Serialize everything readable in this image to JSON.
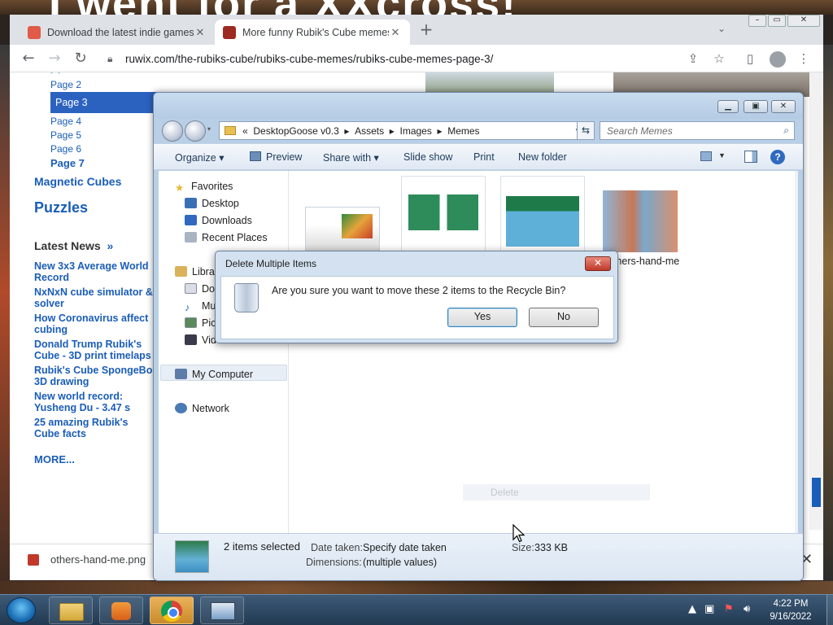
{
  "wallpaper_text": "I went for a XXcross!",
  "chrome": {
    "tabs": [
      {
        "title": "Download the latest indie games",
        "fav_color": "#e05a47"
      },
      {
        "title": "More funny Rubik's Cube memes",
        "fav_color": "#9c2a20"
      }
    ],
    "new_tab": "+",
    "tab_close": "✕",
    "url": "ruwix.com/the-rubiks-cube/rubiks-cube-memes/rubiks-cube-memes-page-3/",
    "download": {
      "filename": "others-hand-me.png"
    }
  },
  "webpage": {
    "subpages": [
      "Page 2",
      "Page 3",
      "Page 4",
      "Page 5",
      "Page 6",
      "Page 7"
    ],
    "magnetic": "Magnetic Cubes",
    "puzzles": "Puzzles",
    "latest_news": "Latest News",
    "latest_arrow": "»",
    "news": [
      [
        "New 3x3 Average World",
        "Record"
      ],
      [
        "NxNxN cube simulator &",
        "solver"
      ],
      [
        "How Coronavirus affect",
        "cubing"
      ],
      [
        "Donald Trump Rubik's",
        "Cube - 3D print timelaps"
      ],
      [
        "Rubik's Cube SpongeBo",
        "3D drawing"
      ],
      [
        "New world record:",
        "Yusheng Du - 3.47 s"
      ],
      [
        "25 amazing Rubik's",
        "Cube facts"
      ]
    ],
    "more": "MORE..."
  },
  "explorer": {
    "breadcrumb": [
      "«",
      "DesktopGoose v0.3",
      "Assets",
      "Images",
      "Memes"
    ],
    "search_placeholder": "Search Memes",
    "commands": {
      "organize": "Organize ▾",
      "preview": "Preview",
      "share": "Share with ▾",
      "slideshow": "Slide show",
      "print": "Print",
      "new_folder": "New folder"
    },
    "nav": {
      "favorites": "Favorites",
      "desktop": "Desktop",
      "downloads": "Downloads",
      "recent": "Recent Places",
      "libraries": "Libra",
      "documents": "Doc",
      "music": "Mu",
      "pictures": "Pic",
      "videos": "Vid",
      "computer": "My Computer",
      "network": "Network"
    },
    "file_label": "others-hand-me",
    "ghost_label": "Delete",
    "details": {
      "selected": "2 items selected",
      "date_label": "Date taken:",
      "date_value": "Specify date taken",
      "dim_label": "Dimensions:",
      "dim_value": "(multiple values)",
      "size_label": "Size:",
      "size_value": "333 KB"
    }
  },
  "dialog": {
    "title": "Delete Multiple Items",
    "message": "Are you sure you want to move these 2 items to the Recycle Bin?",
    "yes": "Yes",
    "no": "No",
    "close": "✕"
  },
  "taskbar": {
    "time": "4:22 PM",
    "date": "9/16/2022"
  }
}
